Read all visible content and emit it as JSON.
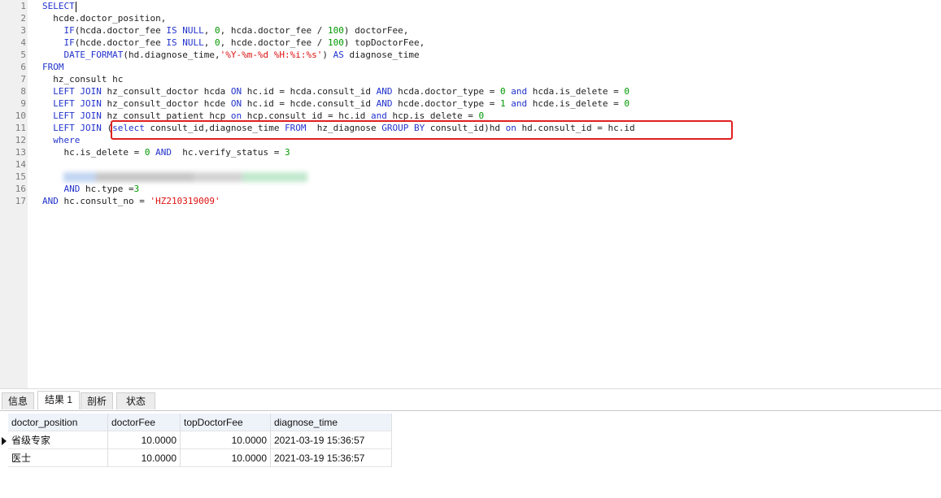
{
  "editor": {
    "lines": [
      {
        "n": "1",
        "t": "SELECT"
      },
      {
        "n": "2",
        "t": "  hcde.doctor_position,"
      },
      {
        "n": "3",
        "t": "    IF(hcda.doctor_fee IS NULL, 0, hcda.doctor_fee / 100) doctorFee,"
      },
      {
        "n": "4",
        "t": "    IF(hcde.doctor_fee IS NULL, 0, hcde.doctor_fee / 100) topDoctorFee,"
      },
      {
        "n": "5",
        "t": "    DATE_FORMAT(hd.diagnose_time,'%Y-%m-%d %H:%i:%s') AS diagnose_time"
      },
      {
        "n": "6",
        "t": "FROM"
      },
      {
        "n": "7",
        "t": "  hz_consult hc"
      },
      {
        "n": "8",
        "t": "  LEFT JOIN hz_consult_doctor hcda ON hc.id = hcda.consult_id AND hcda.doctor_type = 0 and hcda.is_delete = 0"
      },
      {
        "n": "9",
        "t": "  LEFT JOIN hz_consult_doctor hcde ON hc.id = hcde.consult_id AND hcde.doctor_type = 1 and hcde.is_delete = 0"
      },
      {
        "n": "10",
        "t": "  LEFT JOIN hz_consult_patient hcp on hcp.consult_id = hc.id and hcp.is_delete = 0"
      },
      {
        "n": "11",
        "t": "  LEFT JOIN (select consult_id,diagnose_time FROM  hz_diagnose GROUP BY consult_id)hd on hd.consult_id = hc.id"
      },
      {
        "n": "12",
        "t": "  where"
      },
      {
        "n": "13",
        "t": "    hc.is_delete = 0 AND  hc.verify_status = 3"
      },
      {
        "n": "14",
        "t": ""
      },
      {
        "n": "15",
        "t": ""
      },
      {
        "n": "16",
        "t": "    AND hc.type =3"
      },
      {
        "n": "17",
        "t": "AND hc.consult_no = 'HZ210319009'"
      }
    ]
  },
  "tabs": [
    {
      "label": "信息",
      "active": false
    },
    {
      "label": "结果 1",
      "active": true
    },
    {
      "label": "剖析",
      "active": false
    },
    {
      "label": "状态",
      "active": false
    }
  ],
  "results": {
    "columns": [
      "doctor_position",
      "doctorFee",
      "topDoctorFee",
      "diagnose_time"
    ],
    "rows": [
      [
        "省级专家",
        "10.0000",
        "10.0000",
        "2021-03-19 15:36:57"
      ],
      [
        "医士",
        "10.0000",
        "10.0000",
        "2021-03-19 15:36:57"
      ]
    ]
  }
}
